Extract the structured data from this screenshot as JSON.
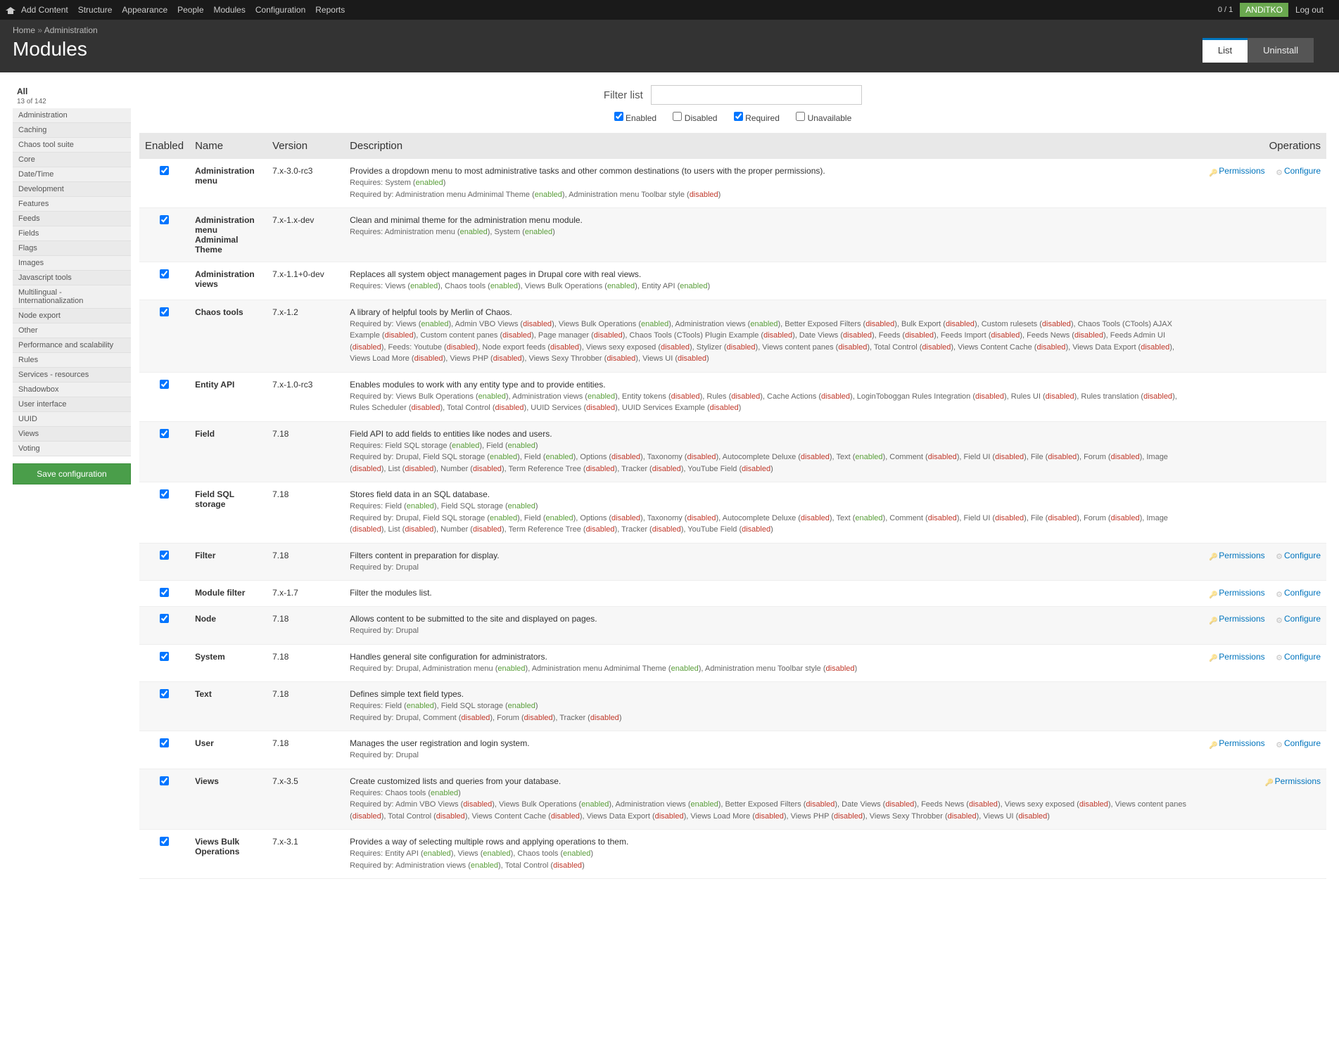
{
  "toolbar": {
    "items": [
      "Add Content",
      "Structure",
      "Appearance",
      "People",
      "Modules",
      "Configuration",
      "Reports"
    ],
    "counter": "0 / 1",
    "user": "ANDiTKO",
    "logout": "Log out"
  },
  "bc": {
    "home": "Home",
    "sep": " » ",
    "admin": "Administration"
  },
  "title": "Modules",
  "tabs": {
    "list": "List",
    "uninstall": "Uninstall"
  },
  "sidebar": {
    "all": "All",
    "count": "13 of 142",
    "items": [
      "Administration",
      "Caching",
      "Chaos tool suite",
      "Core",
      "Date/Time",
      "Development",
      "Features",
      "Feeds",
      "Fields",
      "Flags",
      "Images",
      "Javascript tools",
      "Multilingual - Internationalization",
      "Node export",
      "Other",
      "Performance and scalability",
      "Rules",
      "Services - resources",
      "Shadowbox",
      "User interface",
      "UUID",
      "Views",
      "Voting"
    ],
    "save": "Save configuration"
  },
  "filter": {
    "label": "Filter list",
    "checks": {
      "enabled": "Enabled",
      "disabled": "Disabled",
      "required": "Required",
      "unavailable": "Unavailable"
    }
  },
  "th": {
    "en": "Enabled",
    "name": "Name",
    "ver": "Version",
    "desc": "Description",
    "ops": "Operations"
  },
  "ops": {
    "perm": "Permissions",
    "conf": "Configure"
  },
  "rows": [
    {
      "n": "Administration menu",
      "v": "7.x-3.0-rc3",
      "d": "Provides a dropdown menu to most administrative tasks and other common destinations (to users with the proper permissions).",
      "s": "Requires: System (<span class=st-en>enabled</span>)<br>Required by: Administration menu Adminimal Theme (<span class=st-en>enabled</span>), Administration menu Toolbar style (<span class=st-dis>disabled</span>)",
      "p": 1,
      "c": 1
    },
    {
      "n": "Administration menu Adminimal Theme",
      "v": "7.x-1.x-dev",
      "d": "Clean and minimal theme for the administration menu module.",
      "s": "Requires: Administration menu (<span class=st-en>enabled</span>), System (<span class=st-en>enabled</span>)"
    },
    {
      "n": "Administration views",
      "v": "7.x-1.1+0-dev",
      "d": "Replaces all system object management pages in Drupal core with real views.",
      "s": "Requires: Views (<span class=st-en>enabled</span>), Chaos tools (<span class=st-en>enabled</span>), Views Bulk Operations (<span class=st-en>enabled</span>), Entity API (<span class=st-en>enabled</span>)"
    },
    {
      "n": "Chaos tools",
      "v": "7.x-1.2",
      "d": "A library of helpful tools by Merlin of Chaos.",
      "s": "Required by: Views (<span class=st-en>enabled</span>), Admin VBO Views (<span class=st-dis>disabled</span>), Views Bulk Operations (<span class=st-en>enabled</span>), Administration views (<span class=st-en>enabled</span>), Better Exposed Filters (<span class=st-dis>disabled</span>), Bulk Export (<span class=st-dis>disabled</span>), Custom rulesets (<span class=st-dis>disabled</span>), Chaos Tools (CTools) AJAX Example (<span class=st-dis>disabled</span>), Custom content panes (<span class=st-dis>disabled</span>), Page manager (<span class=st-dis>disabled</span>), Chaos Tools (CTools) Plugin Example (<span class=st-dis>disabled</span>), Date Views (<span class=st-dis>disabled</span>), Feeds (<span class=st-dis>disabled</span>), Feeds Import (<span class=st-dis>disabled</span>), Feeds News (<span class=st-dis>disabled</span>), Feeds Admin UI (<span class=st-dis>disabled</span>), Feeds: Youtube (<span class=st-dis>disabled</span>), Node export feeds (<span class=st-dis>disabled</span>), Views sexy exposed (<span class=st-dis>disabled</span>), Stylizer (<span class=st-dis>disabled</span>), Views content panes (<span class=st-dis>disabled</span>), Total Control (<span class=st-dis>disabled</span>), Views Content Cache (<span class=st-dis>disabled</span>), Views Data Export (<span class=st-dis>disabled</span>), Views Load More (<span class=st-dis>disabled</span>), Views PHP (<span class=st-dis>disabled</span>), Views Sexy Throbber (<span class=st-dis>disabled</span>), Views UI (<span class=st-dis>disabled</span>)"
    },
    {
      "n": "Entity API",
      "v": "7.x-1.0-rc3",
      "d": "Enables modules to work with any entity type and to provide entities.",
      "s": "Required by: Views Bulk Operations (<span class=st-en>enabled</span>), Administration views (<span class=st-en>enabled</span>), Entity tokens (<span class=st-dis>disabled</span>), Rules (<span class=st-dis>disabled</span>), Cache Actions (<span class=st-dis>disabled</span>), LoginToboggan Rules Integration (<span class=st-dis>disabled</span>), Rules UI (<span class=st-dis>disabled</span>), Rules translation (<span class=st-dis>disabled</span>), Rules Scheduler (<span class=st-dis>disabled</span>), Total Control (<span class=st-dis>disabled</span>), UUID Services (<span class=st-dis>disabled</span>), UUID Services Example (<span class=st-dis>disabled</span>)"
    },
    {
      "n": "Field",
      "v": "7.18",
      "d": "Field API to add fields to entities like nodes and users.",
      "s": "Requires: Field SQL storage (<span class=st-en>enabled</span>), Field (<span class=st-en>enabled</span>)<br>Required by: Drupal, Field SQL storage (<span class=st-en>enabled</span>), Field (<span class=st-en>enabled</span>), Options (<span class=st-dis>disabled</span>), Taxonomy (<span class=st-dis>disabled</span>), Autocomplete Deluxe (<span class=st-dis>disabled</span>), Text (<span class=st-en>enabled</span>), Comment (<span class=st-dis>disabled</span>), Field UI (<span class=st-dis>disabled</span>), File (<span class=st-dis>disabled</span>), Forum (<span class=st-dis>disabled</span>), Image (<span class=st-dis>disabled</span>), List (<span class=st-dis>disabled</span>), Number (<span class=st-dis>disabled</span>), Term Reference Tree (<span class=st-dis>disabled</span>), Tracker (<span class=st-dis>disabled</span>), YouTube Field (<span class=st-dis>disabled</span>)"
    },
    {
      "n": "Field SQL storage",
      "v": "7.18",
      "d": "Stores field data in an SQL database.",
      "s": "Requires: Field (<span class=st-en>enabled</span>), Field SQL storage (<span class=st-en>enabled</span>)<br>Required by: Drupal, Field SQL storage (<span class=st-en>enabled</span>), Field (<span class=st-en>enabled</span>), Options (<span class=st-dis>disabled</span>), Taxonomy (<span class=st-dis>disabled</span>), Autocomplete Deluxe (<span class=st-dis>disabled</span>), Text (<span class=st-en>enabled</span>), Comment (<span class=st-dis>disabled</span>), Field UI (<span class=st-dis>disabled</span>), File (<span class=st-dis>disabled</span>), Forum (<span class=st-dis>disabled</span>), Image (<span class=st-dis>disabled</span>), List (<span class=st-dis>disabled</span>), Number (<span class=st-dis>disabled</span>), Term Reference Tree (<span class=st-dis>disabled</span>), Tracker (<span class=st-dis>disabled</span>), YouTube Field (<span class=st-dis>disabled</span>)"
    },
    {
      "n": "Filter",
      "v": "7.18",
      "d": "Filters content in preparation for display.",
      "s": "Required by: Drupal",
      "p": 1,
      "c": 1
    },
    {
      "n": "Module filter",
      "v": "7.x-1.7",
      "d": "Filter the modules list.",
      "s": "",
      "p": 1,
      "c": 1
    },
    {
      "n": "Node",
      "v": "7.18",
      "d": "Allows content to be submitted to the site and displayed on pages.",
      "s": "Required by: Drupal",
      "p": 1,
      "c": 1
    },
    {
      "n": "System",
      "v": "7.18",
      "d": "Handles general site configuration for administrators.",
      "s": "Required by: Drupal, Administration menu (<span class=st-en>enabled</span>), Administration menu Adminimal Theme (<span class=st-en>enabled</span>), Administration menu Toolbar style (<span class=st-dis>disabled</span>)",
      "p": 1,
      "c": 1
    },
    {
      "n": "Text",
      "v": "7.18",
      "d": "Defines simple text field types.",
      "s": "Requires: Field (<span class=st-en>enabled</span>), Field SQL storage (<span class=st-en>enabled</span>)<br>Required by: Drupal, Comment (<span class=st-dis>disabled</span>), Forum (<span class=st-dis>disabled</span>), Tracker (<span class=st-dis>disabled</span>)"
    },
    {
      "n": "User",
      "v": "7.18",
      "d": "Manages the user registration and login system.",
      "s": "Required by: Drupal",
      "p": 1,
      "c": 1
    },
    {
      "n": "Views",
      "v": "7.x-3.5",
      "d": "Create customized lists and queries from your database.",
      "s": "Requires: Chaos tools (<span class=st-en>enabled</span>)<br>Required by: Admin VBO Views (<span class=st-dis>disabled</span>), Views Bulk Operations (<span class=st-en>enabled</span>), Administration views (<span class=st-en>enabled</span>), Better Exposed Filters (<span class=st-dis>disabled</span>), Date Views (<span class=st-dis>disabled</span>), Feeds News (<span class=st-dis>disabled</span>), Views sexy exposed (<span class=st-dis>disabled</span>), Views content panes (<span class=st-dis>disabled</span>), Total Control (<span class=st-dis>disabled</span>), Views Content Cache (<span class=st-dis>disabled</span>), Views Data Export (<span class=st-dis>disabled</span>), Views Load More (<span class=st-dis>disabled</span>), Views PHP (<span class=st-dis>disabled</span>), Views Sexy Throbber (<span class=st-dis>disabled</span>), Views UI (<span class=st-dis>disabled</span>)",
      "p": 1
    },
    {
      "n": "Views Bulk Operations",
      "v": "7.x-3.1",
      "d": "Provides a way of selecting multiple rows and applying operations to them.",
      "s": "Requires: Entity API (<span class=st-en>enabled</span>), Views (<span class=st-en>enabled</span>), Chaos tools (<span class=st-en>enabled</span>)<br>Required by: Administration views (<span class=st-en>enabled</span>), Total Control (<span class=st-dis>disabled</span>)"
    }
  ]
}
